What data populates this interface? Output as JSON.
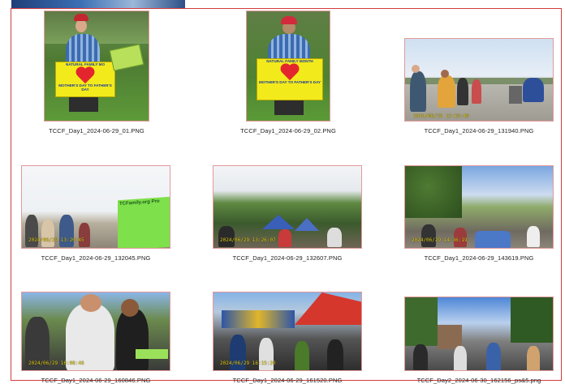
{
  "files": [
    {
      "name": "TCCF_Day1_2024-06-29_01.PNG",
      "stamp": "",
      "sign": {
        "line1": "NATURAL FAMILY MO",
        "line2": "MOTHER'S DAY TO FATHER'S DAY"
      }
    },
    {
      "name": "TCCF_Day1_2024-06-29_02.PNG",
      "stamp": "",
      "sign": {
        "line1": "NATURAL FAMILY MONTH",
        "line2": "MOTHER'S DAY TO FATHER'S DAY"
      }
    },
    {
      "name": "TCCF_Day1_2024-06-29_131940.PNG",
      "stamp": "2024/06/29 13:19:40"
    },
    {
      "name": "TCCF_Day1_2024-06-29_132045.PNG",
      "stamp": "2024/06/29 13:20:45",
      "banner": "TCFamily.org Pro"
    },
    {
      "name": "TCCF_Day1_2024-06-29_132607.PNG",
      "stamp": "2024/06/29 13:26:07"
    },
    {
      "name": "TCCF_Day1_2024-06-29_143619.PNG",
      "stamp": "2024/06/29 14:36:19"
    },
    {
      "name": "TCCF_Day1_2024-06-29_160846.PNG",
      "stamp": "2024/06/29 16:08:46"
    },
    {
      "name": "TCCF_Day1_2024-06-29_161520.PNG",
      "stamp": "2024/06/29 16:15:20"
    },
    {
      "name": "TCCF_Day2_2024-06-30_162156_ps&5.png",
      "stamp": ""
    }
  ]
}
